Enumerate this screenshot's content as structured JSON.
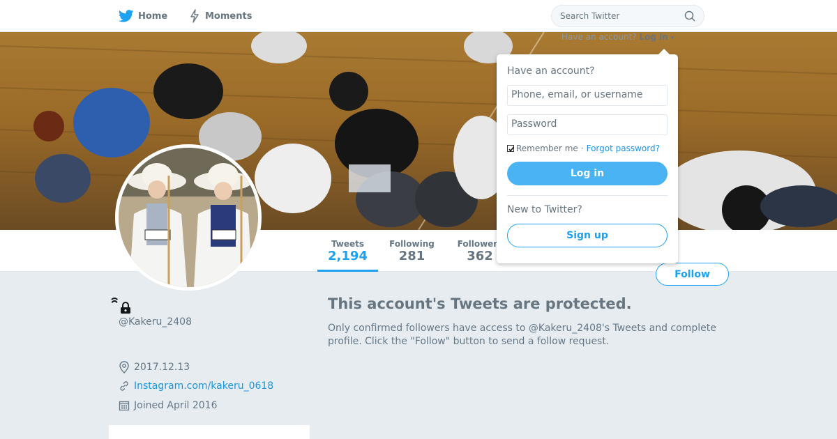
{
  "nav": {
    "home_label": "Home",
    "moments_label": "Moments",
    "search_placeholder": "Search Twitter",
    "have_account_text": "Have an account?",
    "login_link_label": "Log in"
  },
  "profile": {
    "display_name": "ꩰꩰ",
    "handle": "@Kakeru_2408",
    "location": "2017.12.13",
    "url": "Instagram.com/kakeru_0618",
    "joined": "Joined April 2016"
  },
  "stats": [
    {
      "label": "Tweets",
      "value": "2,194"
    },
    {
      "label": "Following",
      "value": "281"
    },
    {
      "label": "Followers",
      "value": "362"
    }
  ],
  "follow_button_label": "Follow",
  "protected": {
    "title": "This account's Tweets are protected.",
    "description": "Only confirmed followers have access to @Kakeru_2408's Tweets and complete profile. Click the \"Follow\" button to send a follow request."
  },
  "login_dropdown": {
    "title": "Have an account?",
    "username_placeholder": "Phone, email, or username",
    "password_placeholder": "Password",
    "remember_label": "Remember me",
    "separator": "·",
    "forgot_label": "Forgot password?",
    "login_button": "Log in",
    "new_to_twitter": "New to Twitter?",
    "signup_button": "Sign up"
  },
  "colors": {
    "accent": "#1da1f2",
    "login_button_bg": "#4ab3f4",
    "background": "#e6ecf0"
  },
  "icons": [
    "twitter-bird-icon",
    "moments-lightning-icon",
    "search-icon",
    "lock-icon",
    "location-pin-icon",
    "link-icon",
    "calendar-icon",
    "caret-down-icon"
  ]
}
